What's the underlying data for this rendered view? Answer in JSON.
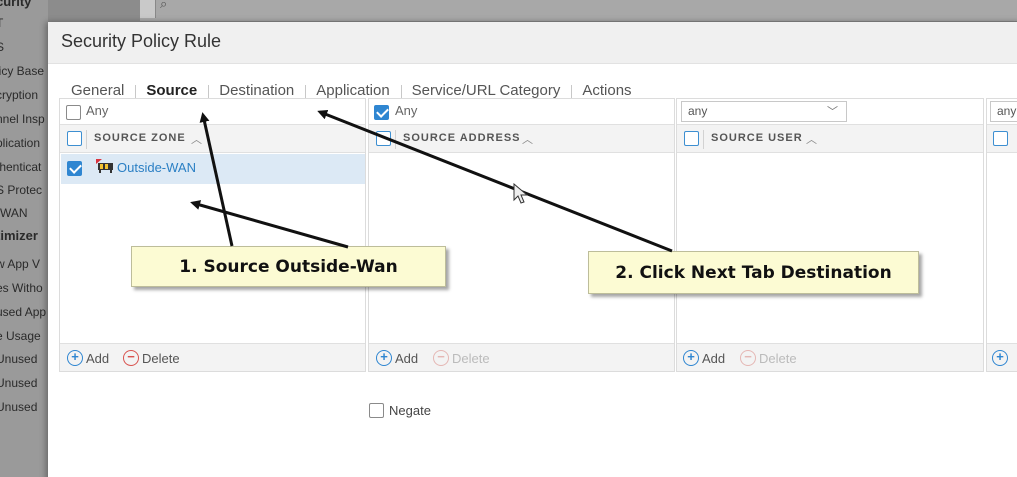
{
  "background": {
    "sidebar_items": [
      "curity",
      "T",
      "S",
      "licy Base",
      "cryption",
      "nnel Insp",
      "plication",
      "thenticat",
      "S Protec",
      "-WAN",
      "timizer",
      "w App V",
      "es Witho",
      "used App",
      "e Usage",
      "Unused",
      "Unused",
      "Unused"
    ]
  },
  "dialog": {
    "title": "Security Policy Rule",
    "tabs": [
      {
        "label": "General"
      },
      {
        "label": "Source"
      },
      {
        "label": "Destination"
      },
      {
        "label": "Application"
      },
      {
        "label": "Service/URL Category"
      },
      {
        "label": "Actions"
      }
    ]
  },
  "panels": {
    "zone": {
      "any_label": "Any",
      "header": "SOURCE ZONE",
      "rows": [
        {
          "label": "Outside-WAN",
          "checked": true
        }
      ],
      "add_label": "Add",
      "delete_label": "Delete"
    },
    "address": {
      "any_label": "Any",
      "header": "SOURCE ADDRESS",
      "add_label": "Add",
      "delete_label": "Delete",
      "negate_label": "Negate"
    },
    "user": {
      "select_value": "any",
      "header": "SOURCE USER",
      "add_label": "Add",
      "delete_label": "Delete"
    },
    "device": {
      "select_value": "any"
    }
  },
  "annotations": {
    "callout1": "1. Source Outside-Wan",
    "callout2": "2. Click Next Tab Destination"
  },
  "colors": {
    "accent": "#2a8fc9",
    "link": "#2a7fc4",
    "delete_red": "#d9534f",
    "callout_bg": "#fcfbd3"
  }
}
